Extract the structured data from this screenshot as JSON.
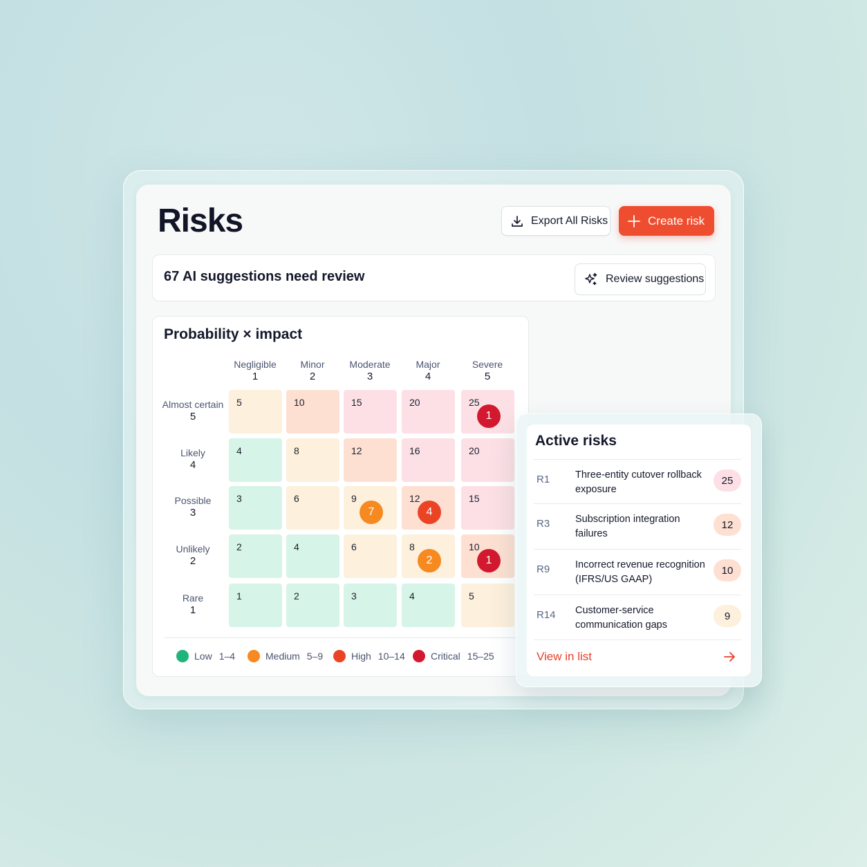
{
  "page": {
    "title": "Risks"
  },
  "header": {
    "export_label": "Export All Risks",
    "create_label": "Create risk"
  },
  "suggestions": {
    "text": "67 AI suggestions need review",
    "button_label": "Review suggestions"
  },
  "matrix": {
    "title": "Probability × impact",
    "impact_columns": [
      {
        "label": "Negligible",
        "value": "1"
      },
      {
        "label": "Minor",
        "value": "2"
      },
      {
        "label": "Moderate",
        "value": "3"
      },
      {
        "label": "Major",
        "value": "4"
      },
      {
        "label": "Severe",
        "value": "5"
      }
    ],
    "probability_rows": [
      {
        "label": "Almost certain",
        "value": "5",
        "scores": [
          "5",
          "10",
          "15",
          "20",
          "25"
        ],
        "levels": [
          "amber",
          "orange",
          "pink",
          "pink",
          "pink"
        ]
      },
      {
        "label": "Likely",
        "value": "4",
        "scores": [
          "4",
          "8",
          "12",
          "16",
          "20"
        ],
        "levels": [
          "green",
          "amber",
          "orange",
          "pink",
          "pink"
        ]
      },
      {
        "label": "Possible",
        "value": "3",
        "scores": [
          "3",
          "6",
          "9",
          "12",
          "15"
        ],
        "levels": [
          "green",
          "amber",
          "amber",
          "orange",
          "pink"
        ]
      },
      {
        "label": "Unlikely",
        "value": "2",
        "scores": [
          "2",
          "4",
          "6",
          "8",
          "10"
        ],
        "levels": [
          "green",
          "green",
          "amber",
          "amber",
          "orange"
        ]
      },
      {
        "label": "Rare",
        "value": "1",
        "scores": [
          "1",
          "2",
          "3",
          "4",
          "5"
        ],
        "levels": [
          "green",
          "green",
          "green",
          "green",
          "amber"
        ]
      }
    ],
    "badges": [
      {
        "row": 0,
        "col": 4,
        "count": "1",
        "severity": "critical"
      },
      {
        "row": 2,
        "col": 2,
        "count": "7",
        "severity": "medium"
      },
      {
        "row": 2,
        "col": 3,
        "count": "4",
        "severity": "high"
      },
      {
        "row": 3,
        "col": 3,
        "count": "2",
        "severity": "medium"
      },
      {
        "row": 3,
        "col": 4,
        "count": "1",
        "severity": "critical"
      }
    ],
    "legend": [
      {
        "name": "Low",
        "range": "1–4",
        "color": "#1fb47a"
      },
      {
        "name": "Medium",
        "range": "5–9",
        "color": "#f6891f"
      },
      {
        "name": "High",
        "range": "10–14",
        "color": "#ea4425"
      },
      {
        "name": "Critical",
        "range": "15–25",
        "color": "#d2192f"
      }
    ]
  },
  "active_risks": {
    "title": "Active risks",
    "items": [
      {
        "id": "R1",
        "name": "Three-entity cutover rollback exposure",
        "score": "25",
        "color": "#fce0e5"
      },
      {
        "id": "R3",
        "name": "Subscription integration failures",
        "score": "12",
        "color": "#fde0d2"
      },
      {
        "id": "R9",
        "name": "Incorrect revenue recognition (IFRS/US GAAP)",
        "score": "10",
        "color": "#fde0d2"
      },
      {
        "id": "R14",
        "name": "Customer-service communication gaps",
        "score": "9",
        "color": "#fdf0dc"
      }
    ],
    "view_link": "View in list"
  },
  "colors": {
    "accent": "#ef4d2f",
    "link": "#e8402a"
  }
}
